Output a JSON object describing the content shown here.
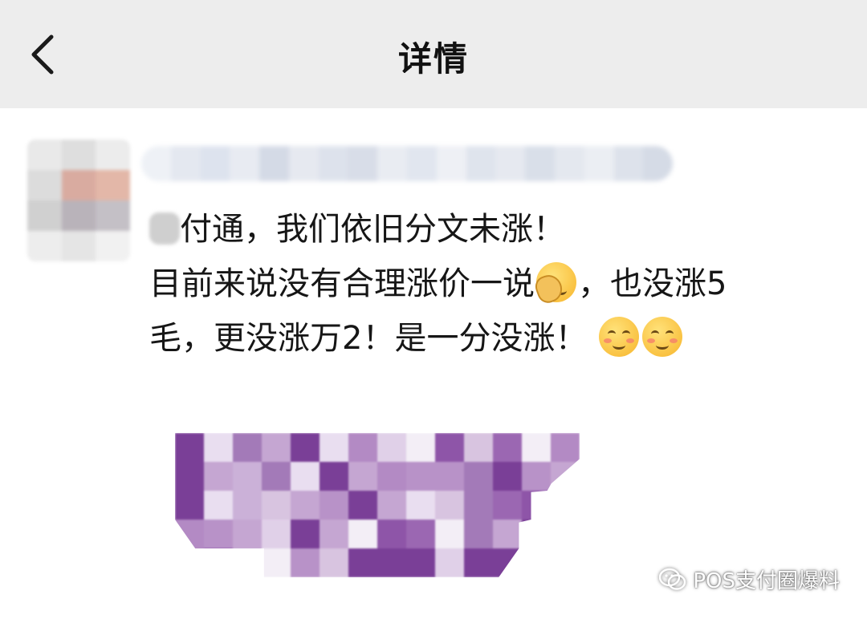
{
  "header": {
    "title": "详情",
    "back_icon": "chevron-left-icon"
  },
  "post": {
    "line1_rest": "付通，我们依旧分文未涨！",
    "line2": "目前来说没有合理涨价一说",
    "line2_tail": "，也没涨5",
    "line3": "毛，更没涨万2！是一分没涨！",
    "emojis": [
      "facepalm-emoji",
      "blush-emoji",
      "blush-emoji"
    ]
  },
  "watermark": {
    "text": "POS支付圈爆料",
    "icon": "wechat-icon"
  },
  "colors": {
    "topbar_bg": "#ededed",
    "mosaic_purple": "#8e55a8",
    "text": "#161616"
  }
}
